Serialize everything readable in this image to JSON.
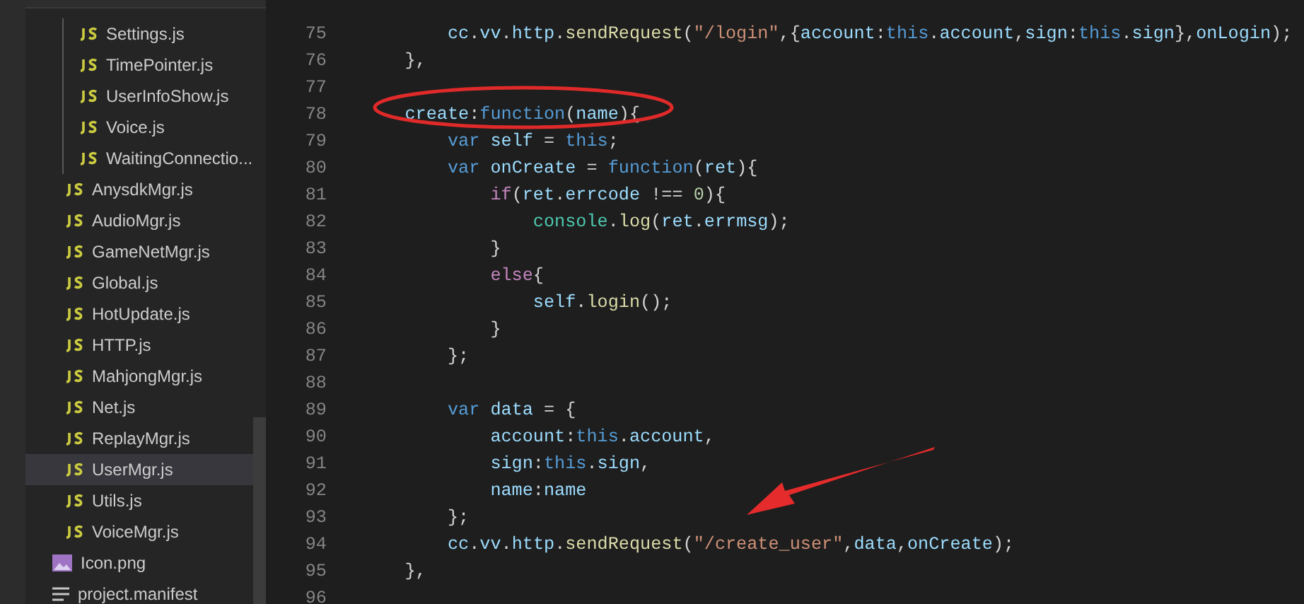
{
  "sidebar": {
    "tree": [
      {
        "children": [
          {
            "children": [
              {
                "label": "Settings.js",
                "kind": "js",
                "selected": false
              },
              {
                "label": "TimePointer.js",
                "kind": "js",
                "selected": false
              },
              {
                "label": "UserInfoShow.js",
                "kind": "js",
                "selected": false
              },
              {
                "label": "Voice.js",
                "kind": "js",
                "selected": false
              },
              {
                "label": "WaitingConnectio...",
                "kind": "js",
                "selected": false
              }
            ]
          },
          {
            "label": "AnysdkMgr.js",
            "kind": "js",
            "selected": false
          },
          {
            "label": "AudioMgr.js",
            "kind": "js",
            "selected": false
          },
          {
            "label": "GameNetMgr.js",
            "kind": "js",
            "selected": false
          },
          {
            "label": "Global.js",
            "kind": "js",
            "selected": false
          },
          {
            "label": "HotUpdate.js",
            "kind": "js",
            "selected": false
          },
          {
            "label": "HTTP.js",
            "kind": "js",
            "selected": false
          },
          {
            "label": "MahjongMgr.js",
            "kind": "js",
            "selected": false
          },
          {
            "label": "Net.js",
            "kind": "js",
            "selected": false
          },
          {
            "label": "ReplayMgr.js",
            "kind": "js",
            "selected": false
          },
          {
            "label": "UserMgr.js",
            "kind": "js",
            "selected": true
          },
          {
            "label": "Utils.js",
            "kind": "js",
            "selected": false
          },
          {
            "label": "VoiceMgr.js",
            "kind": "js",
            "selected": false
          }
        ]
      },
      {
        "label": "Icon.png",
        "kind": "image",
        "selected": false
      },
      {
        "label": "project.manifest",
        "kind": "text",
        "selected": false
      }
    ]
  },
  "editor": {
    "lines": [
      {
        "number": "75",
        "tokens": [
          {
            "kind": "var",
            "text": "        cc"
          },
          {
            "kind": "plain",
            "text": "."
          },
          {
            "kind": "var",
            "text": "vv"
          },
          {
            "kind": "plain",
            "text": "."
          },
          {
            "kind": "var",
            "text": "http"
          },
          {
            "kind": "plain",
            "text": "."
          },
          {
            "kind": "fn",
            "text": "sendRequest"
          },
          {
            "kind": "plain",
            "text": "("
          },
          {
            "kind": "str",
            "text": "\"/login\""
          },
          {
            "kind": "plain",
            "text": ",{"
          },
          {
            "kind": "var",
            "text": "account"
          },
          {
            "kind": "plain",
            "text": ":"
          },
          {
            "kind": "kw",
            "text": "this"
          },
          {
            "kind": "plain",
            "text": "."
          },
          {
            "kind": "var",
            "text": "account"
          },
          {
            "kind": "plain",
            "text": ","
          },
          {
            "kind": "var",
            "text": "sign"
          },
          {
            "kind": "plain",
            "text": ":"
          },
          {
            "kind": "kw",
            "text": "this"
          },
          {
            "kind": "plain",
            "text": "."
          },
          {
            "kind": "var",
            "text": "sign"
          },
          {
            "kind": "plain",
            "text": "},"
          },
          {
            "kind": "var",
            "text": "onLogin"
          },
          {
            "kind": "plain",
            "text": ");"
          }
        ]
      },
      {
        "number": "76",
        "tokens": [
          {
            "kind": "plain",
            "text": "    },"
          }
        ]
      },
      {
        "number": "77"
      },
      {
        "number": "78",
        "tokens": [
          {
            "kind": "var",
            "text": "    create"
          },
          {
            "kind": "plain",
            "text": ":"
          },
          {
            "kind": "kw",
            "text": "function"
          },
          {
            "kind": "plain",
            "text": "("
          },
          {
            "kind": "var",
            "text": "name"
          },
          {
            "kind": "plain",
            "text": "){"
          }
        ]
      },
      {
        "number": "79",
        "tokens": [
          {
            "kind": "kw",
            "text": "        var"
          },
          {
            "kind": "var",
            "text": " self"
          },
          {
            "kind": "plain",
            "text": " = "
          },
          {
            "kind": "kw",
            "text": "this"
          },
          {
            "kind": "plain",
            "text": ";"
          }
        ]
      },
      {
        "number": "80",
        "tokens": [
          {
            "kind": "kw",
            "text": "        var"
          },
          {
            "kind": "var",
            "text": " onCreate"
          },
          {
            "kind": "plain",
            "text": " = "
          },
          {
            "kind": "kw",
            "text": "function"
          },
          {
            "kind": "plain",
            "text": "("
          },
          {
            "kind": "var",
            "text": "ret"
          },
          {
            "kind": "plain",
            "text": "){"
          }
        ]
      },
      {
        "number": "81",
        "tokens": [
          {
            "kind": "ctrl",
            "text": "            if"
          },
          {
            "kind": "plain",
            "text": "("
          },
          {
            "kind": "var",
            "text": "ret"
          },
          {
            "kind": "plain",
            "text": "."
          },
          {
            "kind": "var",
            "text": "errcode"
          },
          {
            "kind": "plain",
            "text": " !== "
          },
          {
            "kind": "num",
            "text": "0"
          },
          {
            "kind": "plain",
            "text": "){"
          }
        ]
      },
      {
        "number": "82",
        "tokens": [
          {
            "kind": "type",
            "text": "                console"
          },
          {
            "kind": "plain",
            "text": "."
          },
          {
            "kind": "fn",
            "text": "log"
          },
          {
            "kind": "plain",
            "text": "("
          },
          {
            "kind": "var",
            "text": "ret"
          },
          {
            "kind": "plain",
            "text": "."
          },
          {
            "kind": "var",
            "text": "errmsg"
          },
          {
            "kind": "plain",
            "text": ");"
          }
        ]
      },
      {
        "number": "83",
        "tokens": [
          {
            "kind": "plain",
            "text": "            }"
          }
        ]
      },
      {
        "number": "84",
        "tokens": [
          {
            "kind": "ctrl",
            "text": "            else"
          },
          {
            "kind": "plain",
            "text": "{"
          }
        ]
      },
      {
        "number": "85",
        "tokens": [
          {
            "kind": "var",
            "text": "                self"
          },
          {
            "kind": "plain",
            "text": "."
          },
          {
            "kind": "fn",
            "text": "login"
          },
          {
            "kind": "plain",
            "text": "();"
          }
        ]
      },
      {
        "number": "86",
        "tokens": [
          {
            "kind": "plain",
            "text": "            }"
          }
        ]
      },
      {
        "number": "87",
        "tokens": [
          {
            "kind": "plain",
            "text": "        };"
          }
        ]
      },
      {
        "number": "88"
      },
      {
        "number": "89",
        "tokens": [
          {
            "kind": "kw",
            "text": "        var"
          },
          {
            "kind": "var",
            "text": " data"
          },
          {
            "kind": "plain",
            "text": " = {"
          }
        ]
      },
      {
        "number": "90",
        "tokens": [
          {
            "kind": "var",
            "text": "            account"
          },
          {
            "kind": "plain",
            "text": ":"
          },
          {
            "kind": "kw",
            "text": "this"
          },
          {
            "kind": "plain",
            "text": "."
          },
          {
            "kind": "var",
            "text": "account"
          },
          {
            "kind": "plain",
            "text": ","
          }
        ]
      },
      {
        "number": "91",
        "tokens": [
          {
            "kind": "var",
            "text": "            sign"
          },
          {
            "kind": "plain",
            "text": ":"
          },
          {
            "kind": "kw",
            "text": "this"
          },
          {
            "kind": "plain",
            "text": "."
          },
          {
            "kind": "var",
            "text": "sign"
          },
          {
            "kind": "plain",
            "text": ","
          }
        ]
      },
      {
        "number": "92",
        "tokens": [
          {
            "kind": "var",
            "text": "            name"
          },
          {
            "kind": "plain",
            "text": ":"
          },
          {
            "kind": "var",
            "text": "name"
          }
        ]
      },
      {
        "number": "93",
        "tokens": [
          {
            "kind": "plain",
            "text": "        };"
          }
        ]
      },
      {
        "number": "94",
        "tokens": [
          {
            "kind": "var",
            "text": "        cc"
          },
          {
            "kind": "plain",
            "text": "."
          },
          {
            "kind": "var",
            "text": "vv"
          },
          {
            "kind": "plain",
            "text": "."
          },
          {
            "kind": "var",
            "text": "http"
          },
          {
            "kind": "plain",
            "text": "."
          },
          {
            "kind": "fn",
            "text": "sendRequest"
          },
          {
            "kind": "plain",
            "text": "("
          },
          {
            "kind": "str",
            "text": "\"/create_user\""
          },
          {
            "kind": "plain",
            "text": ","
          },
          {
            "kind": "var",
            "text": "data"
          },
          {
            "kind": "plain",
            "text": ","
          },
          {
            "kind": "var",
            "text": "onCreate"
          },
          {
            "kind": "plain",
            "text": ");"
          }
        ]
      },
      {
        "number": "95",
        "tokens": [
          {
            "kind": "plain",
            "text": "    },"
          }
        ]
      },
      {
        "number": "96"
      }
    ]
  }
}
